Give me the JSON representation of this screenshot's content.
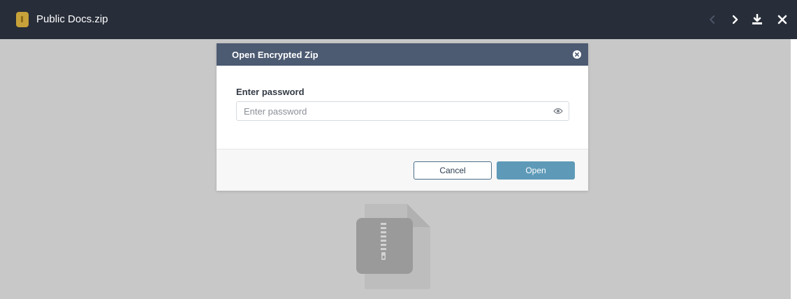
{
  "topbar": {
    "file_name": "Public Docs.zip",
    "icons": {
      "file": "zip-file-icon",
      "prev": "chevron-left-icon",
      "next": "chevron-right-icon",
      "download": "download-icon",
      "close": "close-icon"
    }
  },
  "dialog": {
    "title": "Open Encrypted Zip",
    "field_label": "Enter password",
    "password_value": "",
    "password_placeholder": "Enter password",
    "cancel_label": "Cancel",
    "open_label": "Open",
    "icons": {
      "close": "close-circle-icon",
      "reveal": "eye-icon"
    }
  },
  "viewer": {
    "illustration": "zip-archive-icon"
  },
  "colors": {
    "topbar_bg": "#272d39",
    "viewer_bg": "#c8c8c8",
    "dialog_header_bg": "#4c5a72",
    "open_button_bg": "#5e9ab8",
    "cancel_button_border": "#4a6f8a",
    "zip_icon_gold": "#c7a13a"
  }
}
